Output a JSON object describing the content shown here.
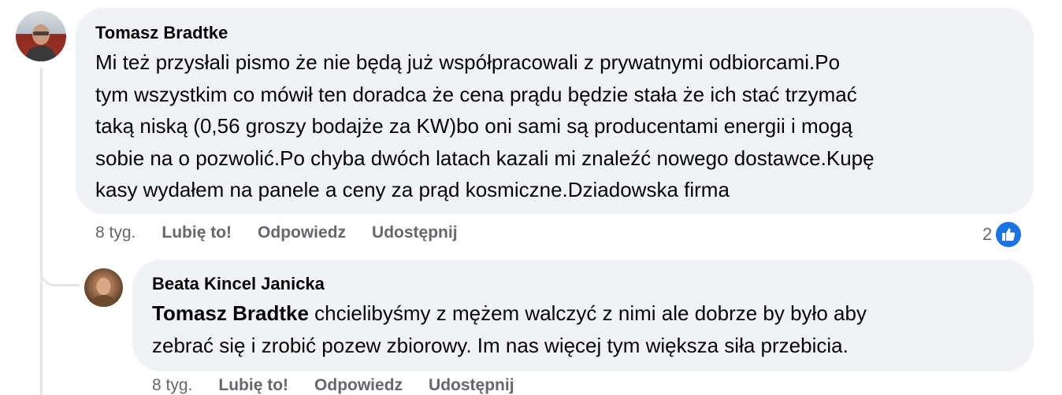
{
  "comment": {
    "author": "Tomasz Bradtke",
    "text_lines": [
      "Mi też przysłali pismo że nie będą już współpracowali z prywatnymi odbiorcami.Po",
      "tym wszystkim co mówił ten doradca że cena prądu będzie stała że ich stać trzymać",
      "taką niską (0,56 groszy bodajże za KW)bo oni sami są producentami energii i mogą",
      "sobie na o pozwolić.Po chyba dwóch latach kazali mi znaleźć nowego dostawce.Kupę",
      "kasy wydałem na panele a ceny za prąd kosmiczne.Dziadowska firma"
    ],
    "time": "8 tyg.",
    "like_label": "Lubię to!",
    "reply_label": "Odpowiedz",
    "share_label": "Udostępnij",
    "reaction_count": "2",
    "reaction_icon": "like-thumb-icon",
    "reaction_color": "#1b74e4"
  },
  "reply": {
    "author": "Beata Kincel Janicka",
    "mention": "Tomasz Bradtke",
    "text_line1_rest": " chcielibyśmy z mężem walczyć z nimi ale dobrze by było aby",
    "text_line2": "zebrać się i zrobić pozew zbiorowy. Im nas więcej tym większa siła przebicia.",
    "time": "8 tyg.",
    "like_label": "Lubię to!",
    "reply_label": "Odpowiedz",
    "share_label": "Udostępnij"
  }
}
